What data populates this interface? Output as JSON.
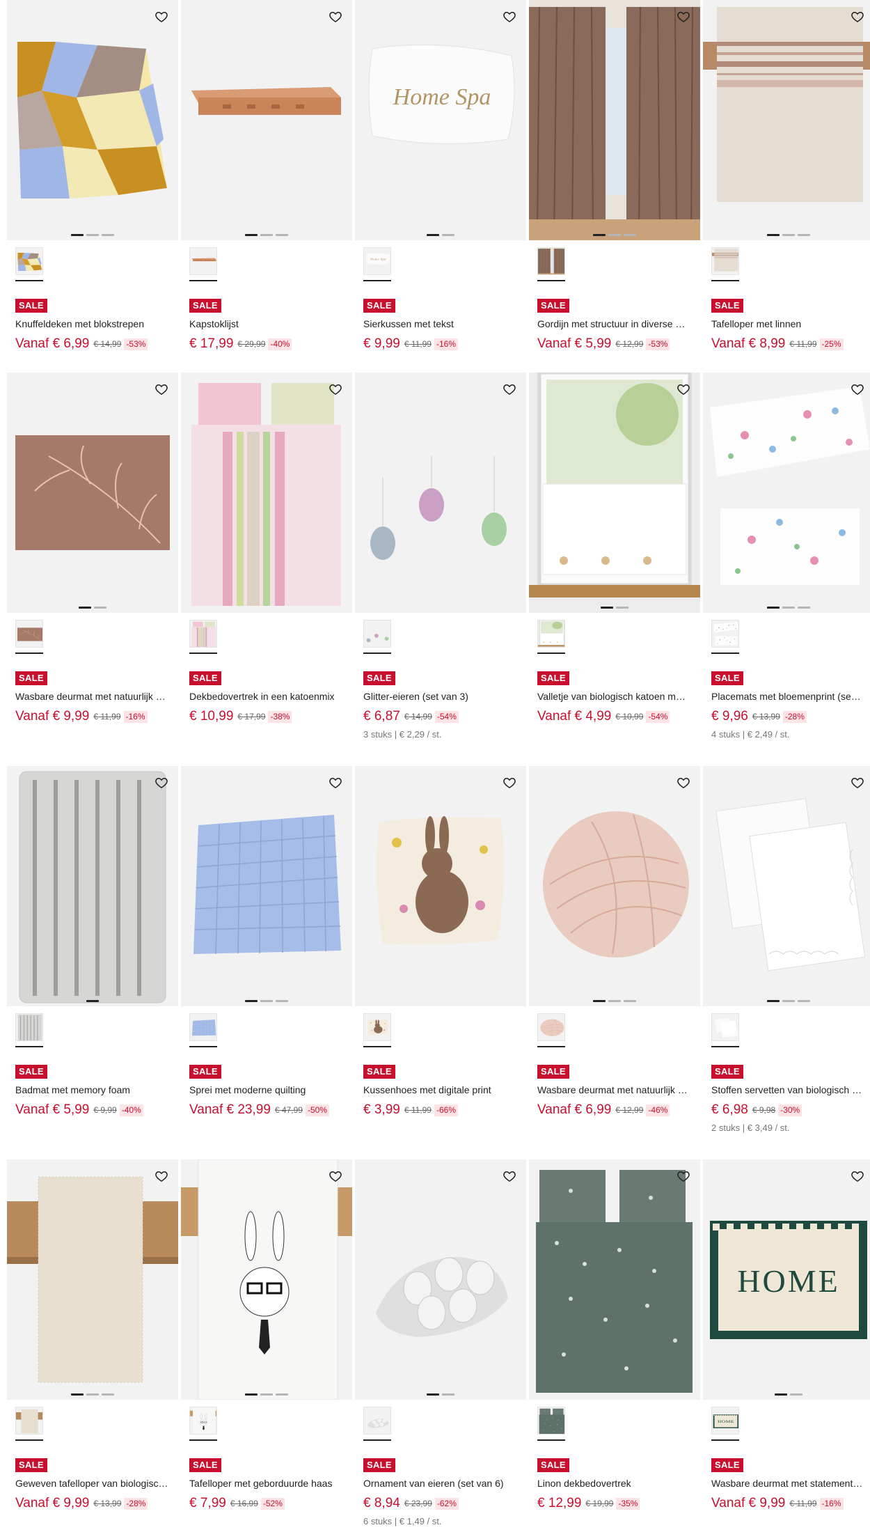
{
  "colors": {
    "sale": "#c8102e",
    "discount_bg": "#fbe3e6",
    "image_bg": "#f2f2f2"
  },
  "products": [
    {
      "name": "Knuffeldeken met blokstrepen",
      "badge": "SALE",
      "price": "Vanaf € 6,99",
      "old": "€ 14,99",
      "disc": "-53%",
      "unit": "",
      "dots": 3,
      "image": "blanket-geometric"
    },
    {
      "name": "Kapstoklijst",
      "badge": "SALE",
      "price": "€ 17,99",
      "old": "€ 29,99",
      "disc": "-40%",
      "unit": "",
      "dots": 3,
      "image": "wooden-shelf"
    },
    {
      "name": "Sierkussen met tekst",
      "badge": "SALE",
      "price": "€ 9,99",
      "old": "€ 11,99",
      "disc": "-16%",
      "unit": "",
      "dots": 2,
      "image": "pillow-text",
      "image_text": "Home Spa"
    },
    {
      "name": "Gordijn met structuur in diverse …",
      "badge": "SALE",
      "price": "Vanaf € 5,99",
      "old": "€ 12,99",
      "disc": "-53%",
      "unit": "",
      "dots": 3,
      "image": "curtain-brown"
    },
    {
      "name": "Tafelloper met linnen",
      "badge": "SALE",
      "price": "Vanaf € 8,99",
      "old": "€ 11,99",
      "disc": "-25%",
      "unit": "",
      "dots": 3,
      "image": "table-runner-stripe"
    },
    {
      "name": "Wasbare deurmat met natuurlijk …",
      "badge": "SALE",
      "price": "Vanaf € 9,99",
      "old": "€ 11,99",
      "disc": "-16%",
      "unit": "",
      "dots": 2,
      "image": "doormat-branch"
    },
    {
      "name": "Dekbedovertrek in een katoenmix",
      "badge": "SALE",
      "price": "€ 10,99",
      "old": "€ 17,99",
      "disc": "-38%",
      "unit": "",
      "dots": 0,
      "image": "duvet-pastel"
    },
    {
      "name": "Glitter-eieren (set van 3)",
      "badge": "SALE",
      "price": "€ 6,87",
      "old": "€ 14,99",
      "disc": "-54%",
      "unit": "3 stuks | € 2,29 / st.",
      "dots": 0,
      "image": "disco-eggs"
    },
    {
      "name": "Valletje van biologisch katoen m…",
      "badge": "SALE",
      "price": "Vanaf € 4,99",
      "old": "€ 10,99",
      "disc": "-54%",
      "unit": "",
      "dots": 2,
      "image": "cafe-curtain"
    },
    {
      "name": "Placemats met bloemenprint (se…",
      "badge": "SALE",
      "price": "€ 9,96",
      "old": "€ 13,99",
      "disc": "-28%",
      "unit": "4 stuks | € 2,49 / st.",
      "dots": 3,
      "image": "placemats-floral"
    },
    {
      "name": "Badmat met memory foam",
      "badge": "SALE",
      "price": "Vanaf € 5,99",
      "old": "€ 9,99",
      "disc": "-40%",
      "unit": "",
      "dots": 1,
      "image": "bathmat-grey"
    },
    {
      "name": "Sprei met moderne quilting",
      "badge": "SALE",
      "price": "Vanaf € 23,99",
      "old": "€ 47,99",
      "disc": "-50%",
      "unit": "",
      "dots": 3,
      "image": "quilt-blue"
    },
    {
      "name": "Kussenhoes met digitale print",
      "badge": "SALE",
      "price": "€ 3,99",
      "old": "€ 11,99",
      "disc": "-66%",
      "unit": "",
      "dots": 0,
      "image": "pillow-rabbit"
    },
    {
      "name": "Wasbare deurmat met natuurlijk …",
      "badge": "SALE",
      "price": "Vanaf € 6,99",
      "old": "€ 12,99",
      "disc": "-46%",
      "unit": "",
      "dots": 3,
      "image": "round-mat"
    },
    {
      "name": "Stoffen servetten van biologisch …",
      "badge": "SALE",
      "price": "€ 6,98",
      "old": "€ 9,98",
      "disc": "-30%",
      "unit": "2 stuks | € 3,49 / st.",
      "dots": 3,
      "image": "napkins-white"
    },
    {
      "name": "Geweven tafelloper van biologisc…",
      "badge": "SALE",
      "price": "Vanaf € 9,99",
      "old": "€ 13,99",
      "disc": "-28%",
      "unit": "",
      "dots": 3,
      "image": "table-runner-beige"
    },
    {
      "name": "Tafelloper met geborduurde haas",
      "badge": "SALE",
      "price": "€ 7,99",
      "old": "€ 16,99",
      "disc": "-52%",
      "unit": "",
      "dots": 3,
      "image": "table-runner-rabbit"
    },
    {
      "name": "Ornament van eieren (set van 6)",
      "badge": "SALE",
      "price": "€ 8,94",
      "old": "€ 23,99",
      "disc": "-62%",
      "unit": "6 stuks | € 1,49 / st.",
      "dots": 2,
      "image": "egg-ornament"
    },
    {
      "name": "Linon dekbedovertrek",
      "badge": "SALE",
      "price": "€ 12,99",
      "old": "€ 19,99",
      "disc": "-35%",
      "unit": "",
      "dots": 0,
      "image": "duvet-green-floral"
    },
    {
      "name": "Wasbare deurmat met statement…",
      "badge": "SALE",
      "price": "Vanaf € 9,99",
      "old": "€ 11,99",
      "disc": "-16%",
      "unit": "",
      "dots": 2,
      "image": "doormat-home",
      "image_text": "HOME"
    }
  ]
}
